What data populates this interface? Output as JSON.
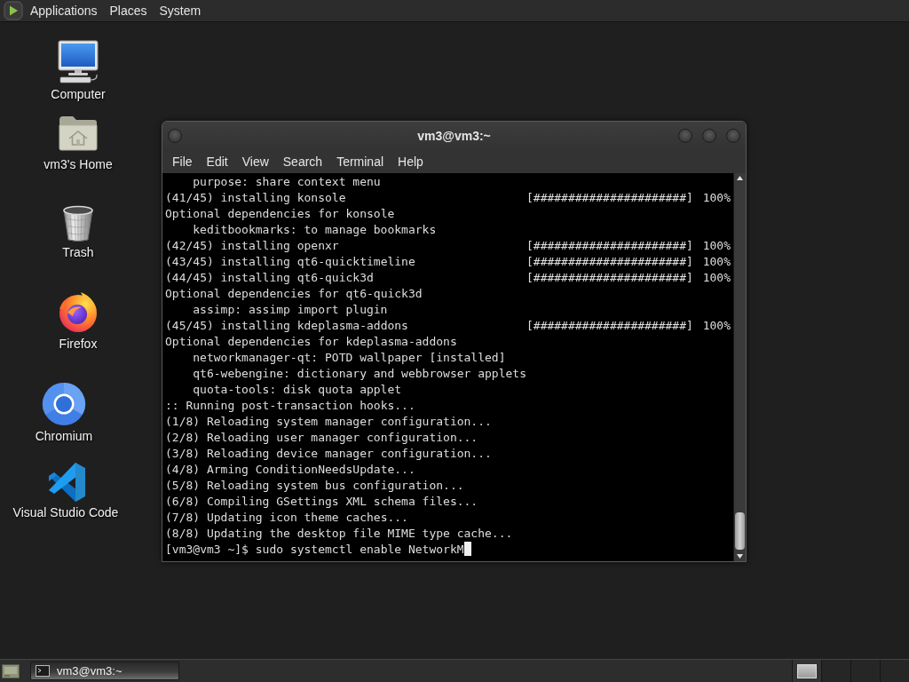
{
  "top_panel": {
    "menus": [
      "Applications",
      "Places",
      "System"
    ]
  },
  "desktop_icons": [
    {
      "kind": "computer",
      "label": "Computer"
    },
    {
      "kind": "home",
      "label": "vm3's Home"
    },
    {
      "kind": "trash",
      "label": "Trash"
    },
    {
      "kind": "firefox",
      "label": "Firefox"
    },
    {
      "kind": "chromium",
      "label": "Chromium"
    },
    {
      "kind": "vscode",
      "label": "Visual Studio Code"
    }
  ],
  "terminal_window": {
    "title": "vm3@vm3:~",
    "menu": [
      "File",
      "Edit",
      "View",
      "Search",
      "Terminal",
      "Help"
    ],
    "lines": [
      {
        "kind": "detail",
        "text": "purpose: share context menu"
      },
      {
        "kind": "install",
        "text": "(41/45) installing konsole",
        "bar": "[######################]",
        "percent": "100%"
      },
      {
        "kind": "output",
        "text": "Optional dependencies for konsole"
      },
      {
        "kind": "detail",
        "text": "keditbookmarks: to manage bookmarks"
      },
      {
        "kind": "install",
        "text": "(42/45) installing openxr",
        "bar": "[######################]",
        "percent": "100%"
      },
      {
        "kind": "install",
        "text": "(43/45) installing qt6-quicktimeline",
        "bar": "[######################]",
        "percent": "100%"
      },
      {
        "kind": "install",
        "text": "(44/45) installing qt6-quick3d",
        "bar": "[######################]",
        "percent": "100%"
      },
      {
        "kind": "output",
        "text": "Optional dependencies for qt6-quick3d"
      },
      {
        "kind": "detail",
        "text": "assimp: assimp import plugin"
      },
      {
        "kind": "install",
        "text": "(45/45) installing kdeplasma-addons",
        "bar": "[######################]",
        "percent": "100%"
      },
      {
        "kind": "output",
        "text": "Optional dependencies for kdeplasma-addons"
      },
      {
        "kind": "detail",
        "text": "networkmanager-qt: POTD wallpaper [installed]"
      },
      {
        "kind": "detail",
        "text": "qt6-webengine: dictionary and webbrowser applets"
      },
      {
        "kind": "detail",
        "text": "quota-tools: disk quota applet"
      },
      {
        "kind": "output",
        "text": ":: Running post-transaction hooks..."
      },
      {
        "kind": "output",
        "text": "(1/8) Reloading system manager configuration..."
      },
      {
        "kind": "output",
        "text": "(2/8) Reloading user manager configuration..."
      },
      {
        "kind": "output",
        "text": "(3/8) Reloading device manager configuration..."
      },
      {
        "kind": "output",
        "text": "(4/8) Arming ConditionNeedsUpdate..."
      },
      {
        "kind": "output",
        "text": "(5/8) Reloading system bus configuration..."
      },
      {
        "kind": "output",
        "text": "(6/8) Compiling GSettings XML schema files..."
      },
      {
        "kind": "output",
        "text": "(7/8) Updating icon theme caches..."
      },
      {
        "kind": "output",
        "text": "(8/8) Updating the desktop file MIME type cache..."
      },
      {
        "kind": "prompt",
        "text": "[vm3@vm3 ~]$ sudo systemctl enable NetworkM"
      }
    ]
  },
  "bottom_panel": {
    "tasks": [
      {
        "label": "vm3@vm3:~"
      }
    ],
    "workspaces": [
      {
        "selected": true
      },
      {
        "selected": false
      },
      {
        "selected": false
      },
      {
        "selected": false
      }
    ]
  }
}
